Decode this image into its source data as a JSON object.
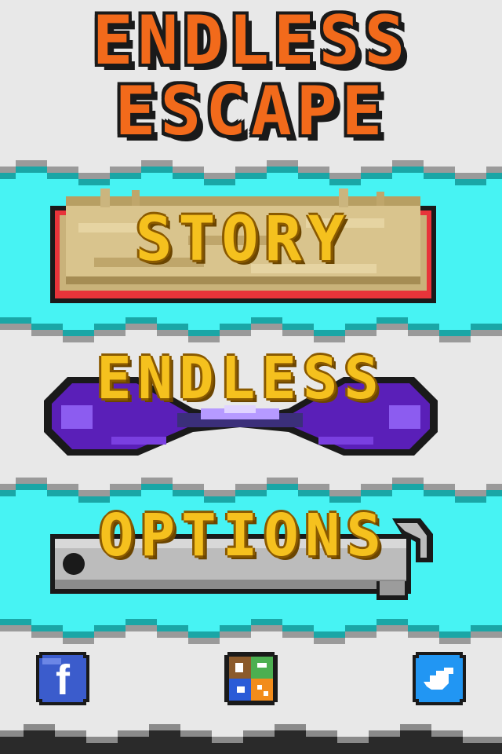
{
  "title": {
    "line1": "ENDLESS",
    "line2": "ESCAPE"
  },
  "menu": {
    "story_label": "STORY",
    "endless_label": "ENDLESS",
    "options_label": "OPTIONS"
  },
  "social": {
    "facebook_letter": "f",
    "facebook_icon": "facebook-icon",
    "games_icon": "game-center-icon",
    "twitter_icon": "twitter-bird-icon"
  },
  "colors": {
    "background": "#e8e8e8",
    "water": "#47f3f3",
    "water_edge": "#1aa6a6",
    "title_orange": "#f26a1b",
    "label_gold": "#f5c11e",
    "story_red": "#e8343a",
    "story_stone": "#c9b27a",
    "endless_purple": "#6a2ad0",
    "options_silver": "#bcbcbc",
    "facebook_blue": "#3b5ccc",
    "twitter_blue": "#2196f3"
  }
}
